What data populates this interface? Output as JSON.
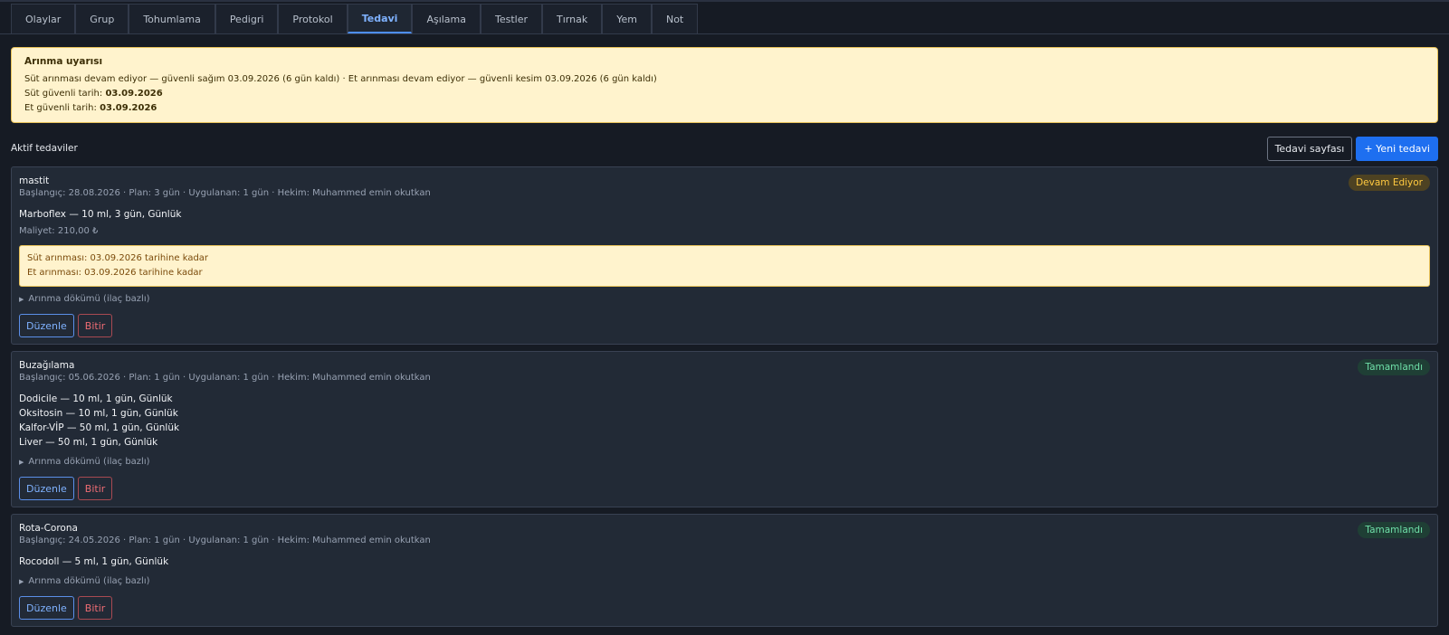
{
  "tabs": [
    "Olaylar",
    "Grup",
    "Tohumlama",
    "Pedigri",
    "Protokol",
    "Tedavi",
    "Aşılama",
    "Testler",
    "Tırnak",
    "Yem",
    "Not"
  ],
  "active_tab": "Tedavi",
  "warning": {
    "title": "Arınma uyarısı",
    "summary": "Süt arınması devam ediyor — güvenli sağım 03.09.2026 (6 gün kaldı) · Et arınması devam ediyor — güvenli kesim 03.09.2026 (6 gün kaldı)",
    "milk_label": "Süt güvenli tarih:",
    "milk_date": "03.09.2026",
    "meat_label": "Et güvenli tarih:",
    "meat_date": "03.09.2026"
  },
  "section": {
    "title": "Aktif tedaviler",
    "page_button": "Tedavi sayfası",
    "new_button": "+ Yeni tedavi"
  },
  "treatments": [
    {
      "title": "mastit",
      "meta": "Başlangıç: 28.08.2026 · Plan: 3 gün · Uygulanan: 1 gün · Hekim: Muhammed emin okutkan",
      "status": "Devam Ediyor",
      "meds": [
        "Marboflex — 10 ml, 3 gün, Günlük"
      ],
      "cost": "Maliyet: 210,00 ₺",
      "withdrawal": [
        "Süt arınması: 03.09.2026 tarihine kadar",
        "Et arınması: 03.09.2026 tarihine kadar"
      ],
      "details": "Arınma dökümü (ilaç bazlı)",
      "edit": "Düzenle",
      "end": "Bitir"
    },
    {
      "title": "Buzağılama",
      "meta": "Başlangıç: 05.06.2026 · Plan: 1 gün · Uygulanan: 1 gün · Hekim: Muhammed emin okutkan",
      "status": "Tamamlandı",
      "meds": [
        "Dodicile — 10 ml, 1 gün, Günlük",
        "Oksitosin — 10 ml, 1 gün, Günlük",
        "Kalfor-VİP — 50 ml, 1 gün, Günlük",
        "Liver — 50 ml, 1 gün, Günlük"
      ],
      "details": "Arınma dökümü (ilaç bazlı)",
      "edit": "Düzenle",
      "end": "Bitir"
    },
    {
      "title": "Rota-Corona",
      "meta": "Başlangıç: 24.05.2026 · Plan: 1 gün · Uygulanan: 1 gün · Hekim: Muhammed emin okutkan",
      "status": "Tamamlandı",
      "meds": [
        "Rocodoll — 5 ml, 1 gün, Günlük"
      ],
      "details": "Arınma dökümü (ilaç bazlı)",
      "edit": "Düzenle",
      "end": "Bitir"
    }
  ]
}
